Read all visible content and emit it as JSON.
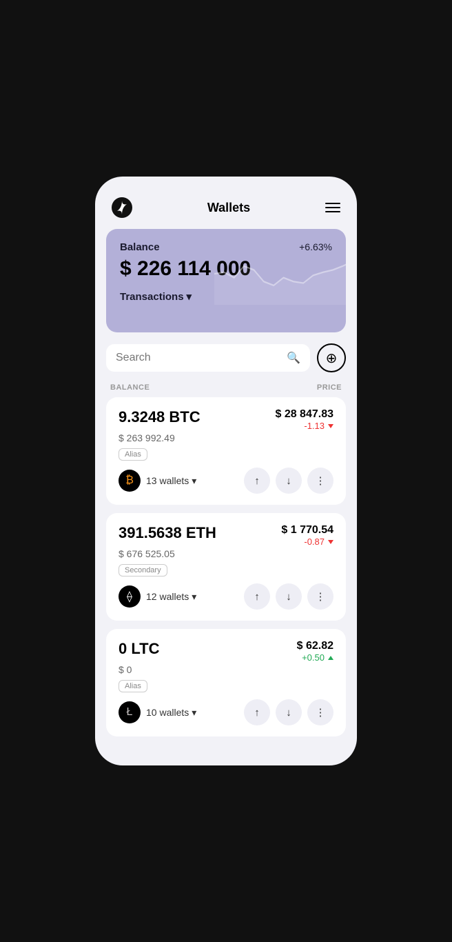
{
  "header": {
    "title": "Wallets",
    "menu_icon": "hamburger-icon",
    "logo_icon": "logo-icon"
  },
  "balance_card": {
    "label": "Balance",
    "percent_change": "+6.63%",
    "amount": "$ 226 114 000",
    "transactions_label": "Transactions"
  },
  "search": {
    "placeholder": "Search",
    "icon": "search-icon",
    "add_icon": "plus-icon"
  },
  "columns": {
    "left": "BALANCE",
    "right": "PRICE"
  },
  "assets": [
    {
      "id": "btc",
      "amount": "9.3248 BTC",
      "usd_value": "$ 263 992.49",
      "tag": "Alias",
      "wallets_count": "13 wallets",
      "price": "$ 28 847.83",
      "change": "-1.13",
      "change_type": "negative",
      "icon_type": "btc",
      "icon_symbol": "₿"
    },
    {
      "id": "eth",
      "amount": "391.5638 ETH",
      "usd_value": "$ 676 525.05",
      "tag": "Secondary",
      "wallets_count": "12 wallets",
      "price": "$ 1 770.54",
      "change": "-0.87",
      "change_type": "negative",
      "icon_type": "eth",
      "icon_symbol": "⬥"
    },
    {
      "id": "ltc",
      "amount": "0 LTC",
      "usd_value": "$ 0",
      "tag": "Alias",
      "wallets_count": "10 wallets",
      "price": "$ 62.82",
      "change": "+0.50",
      "change_type": "positive",
      "icon_type": "ltc",
      "icon_symbol": "Ł"
    }
  ],
  "actions": {
    "send_icon": "send-icon",
    "receive_icon": "receive-icon",
    "more_icon": "more-icon"
  }
}
